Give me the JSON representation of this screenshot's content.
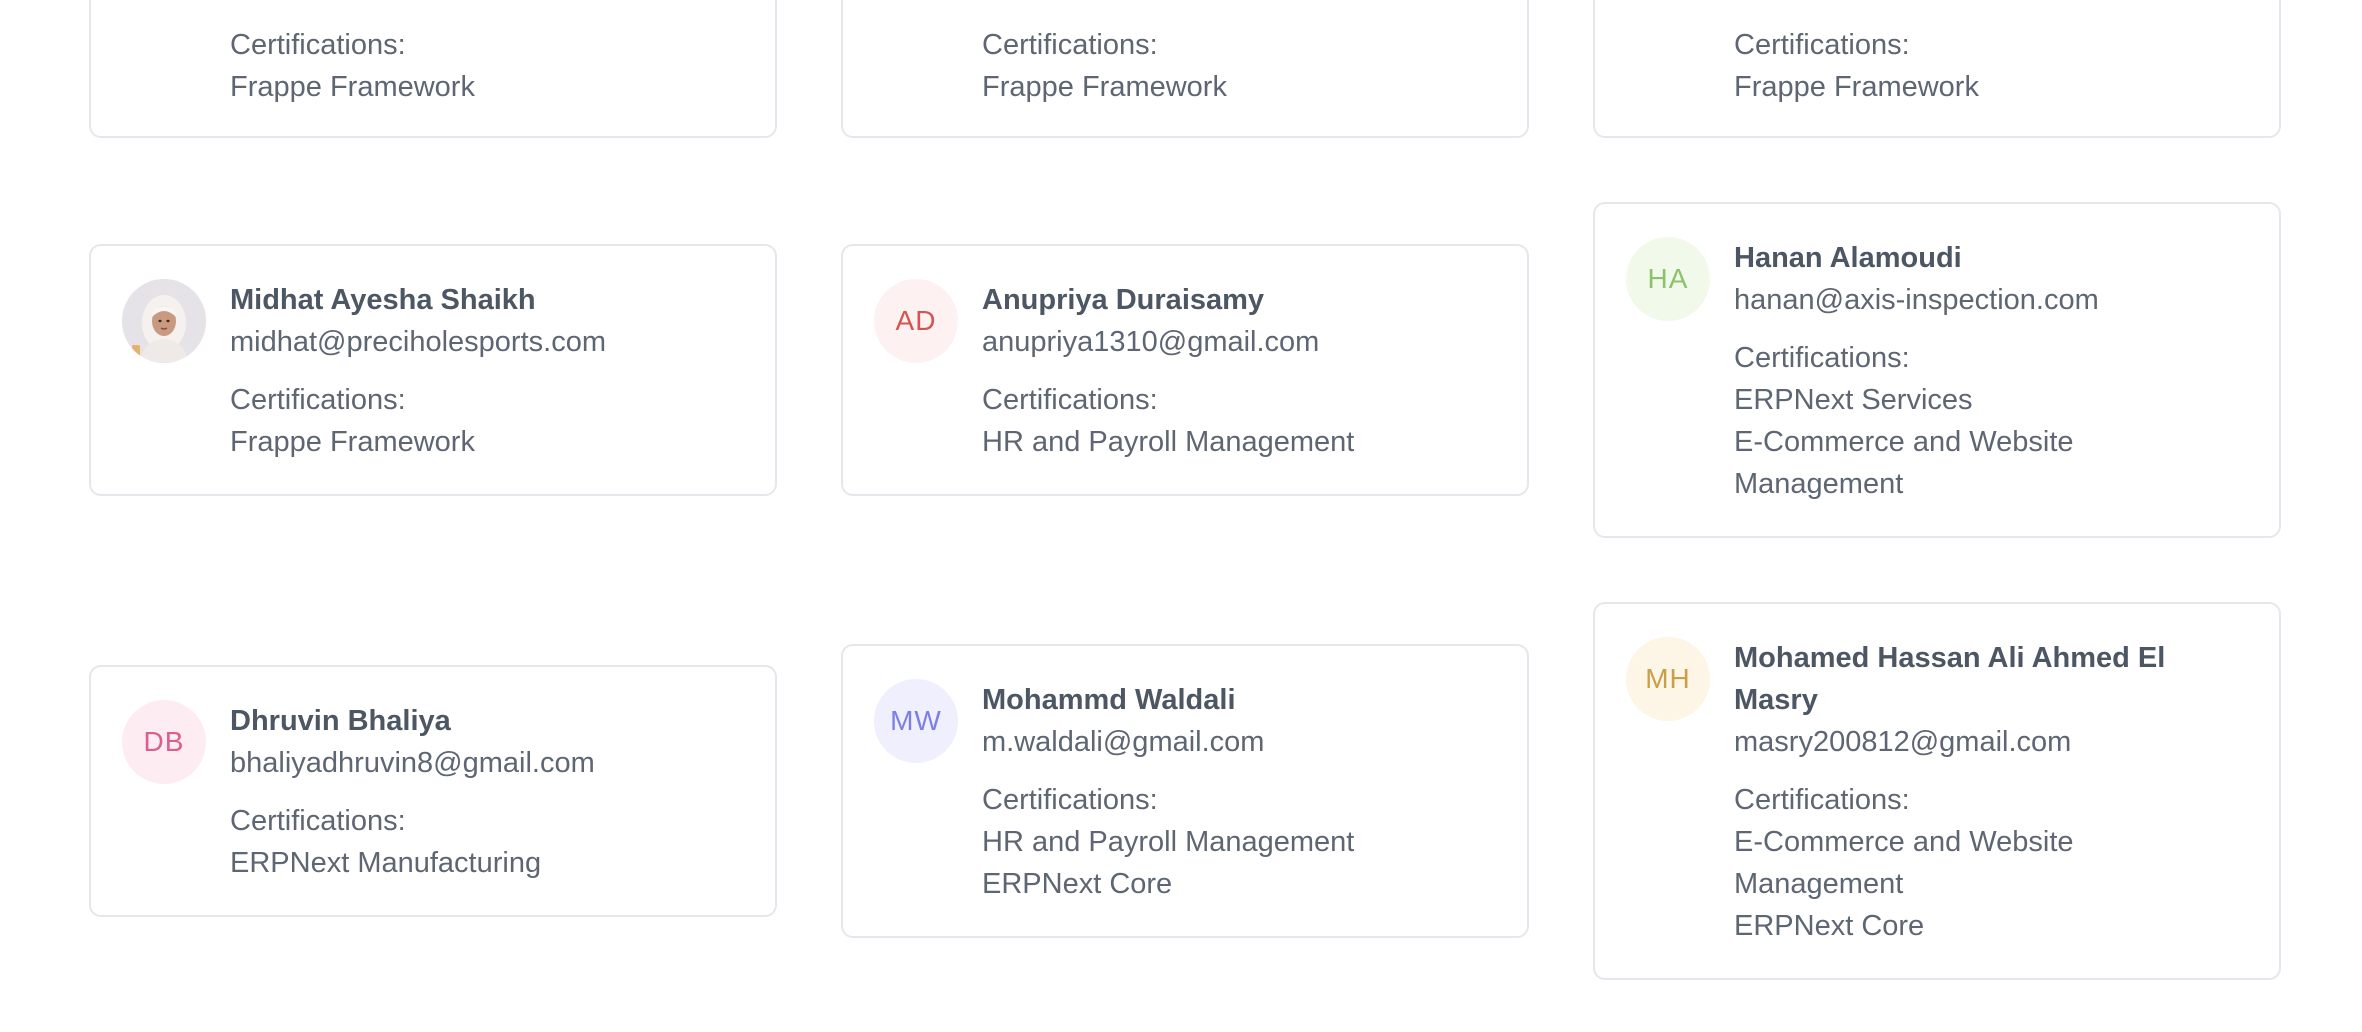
{
  "colors": {
    "card_border": "#e4e7ec",
    "text": "#5d6672",
    "name": "#4d5663"
  },
  "partial_cards": [
    {
      "cert_label": "Certifications:",
      "certifications": [
        "Frappe Framework"
      ]
    },
    {
      "cert_label": "Certifications:",
      "certifications": [
        "Frappe Framework"
      ]
    },
    {
      "cert_label": "Certifications:",
      "certifications": [
        "Frappe Framework"
      ]
    }
  ],
  "members": [
    {
      "name": "Midhat Ayesha Shaikh",
      "email": "midhat@preciholesports.com",
      "avatar": {
        "type": "photo",
        "icon": "person-photo"
      },
      "cert_label": "Certifications:",
      "certifications": [
        "Frappe Framework"
      ]
    },
    {
      "name": "Anupriya Duraisamy",
      "email": "anupriya1310@gmail.com",
      "avatar": {
        "type": "initials",
        "initials": "AD",
        "bg": "#fdf1f1",
        "fg": "#d2564f"
      },
      "cert_label": "Certifications:",
      "certifications": [
        "HR and Payroll Management"
      ]
    },
    {
      "name": "Hanan Alamoudi",
      "email": "hanan@axis-inspection.com",
      "avatar": {
        "type": "initials",
        "initials": "HA",
        "bg": "#f1f9ea",
        "fg": "#8dc26a"
      },
      "cert_label": "Certifications:",
      "certifications": [
        "ERPNext Services",
        "E-Commerce and Website Management"
      ]
    },
    {
      "name": "Dhruvin Bhaliya",
      "email": "bhaliyadhruvin8@gmail.com",
      "avatar": {
        "type": "initials",
        "initials": "DB",
        "bg": "#fdedf2",
        "fg": "#dc5e8c"
      },
      "cert_label": "Certifications:",
      "certifications": [
        "ERPNext Manufacturing"
      ]
    },
    {
      "name": "Mohammd Waldali",
      "email": "m.waldali@gmail.com",
      "avatar": {
        "type": "initials",
        "initials": "MW",
        "bg": "#efeffd",
        "fg": "#7b7fe6"
      },
      "cert_label": "Certifications:",
      "certifications": [
        "HR and Payroll Management",
        "ERPNext Core"
      ]
    },
    {
      "name": "Mohamed Hassan Ali Ahmed El Masry",
      "email": "masry200812@gmail.com",
      "avatar": {
        "type": "initials",
        "initials": "MH",
        "bg": "#fdf5e6",
        "fg": "#c9a04a"
      },
      "cert_label": "Certifications:",
      "certifications": [
        "E-Commerce and Website Management",
        "ERPNext Core"
      ]
    }
  ]
}
